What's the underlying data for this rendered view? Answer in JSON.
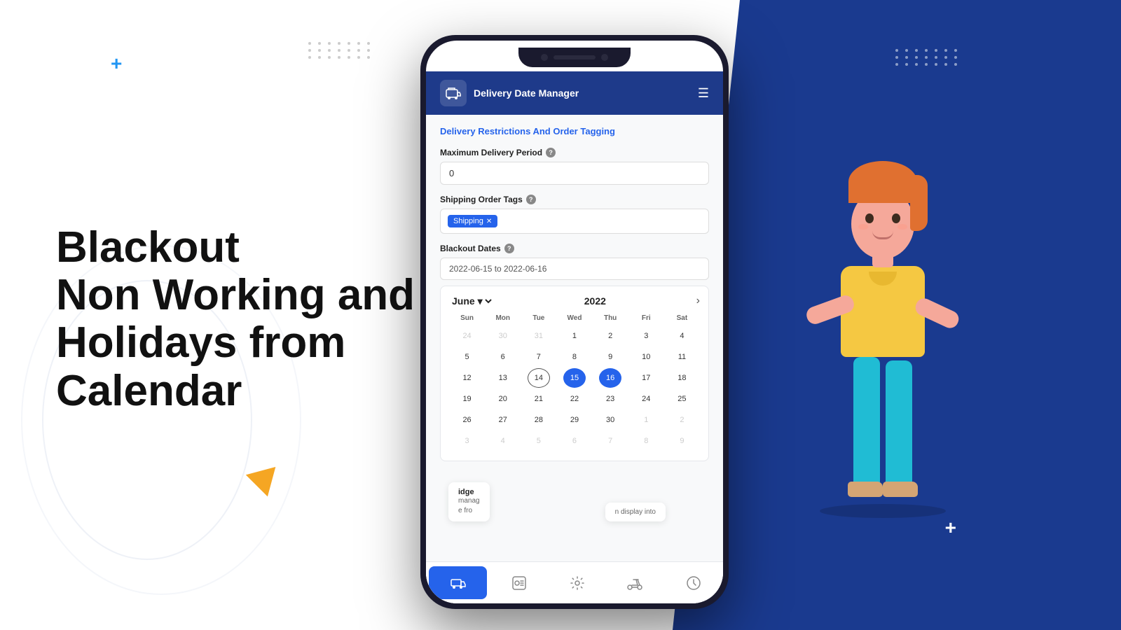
{
  "background": {
    "left_color": "#ffffff",
    "right_color": "#1a3a8f"
  },
  "decorations": {
    "plus_blue": "+",
    "plus_white": "+",
    "triangle_color": "#f5a623",
    "dots_color": "#cccccc",
    "dots_right_color": "rgba(255,255,255,0.5)"
  },
  "headline": {
    "line1": "Blackout",
    "line2": "Non Working and",
    "line3": "Holidays from",
    "line4": "Calendar"
  },
  "app": {
    "header": {
      "title": "Delivery Date\nManager",
      "menu_icon": "☰",
      "logo_icon": "🚚"
    },
    "section_title": "Delivery Restrictions And Order Tagging",
    "fields": {
      "max_delivery_label": "Maximum Delivery Period",
      "max_delivery_value": "0",
      "max_delivery_placeholder": "0",
      "shipping_tags_label": "Shipping Order Tags",
      "tag_text": "Shipping",
      "blackout_label": "Blackout Dates",
      "blackout_value": "2022-06-15 to 2022-06-16"
    },
    "calendar": {
      "month": "June",
      "year": "2022",
      "day_names": [
        "Sun",
        "Mon",
        "Tue",
        "Wed",
        "Thu",
        "Fri",
        "Sat"
      ],
      "weeks": [
        [
          "24",
          "30",
          "31",
          "1",
          "2",
          "3",
          "4"
        ],
        [
          "5",
          "6",
          "7",
          "8",
          "9",
          "10",
          "11"
        ],
        [
          "12",
          "13",
          "14",
          "15",
          "16",
          "17",
          "18"
        ],
        [
          "19",
          "20",
          "21",
          "22",
          "23",
          "24",
          "25"
        ],
        [
          "26",
          "27",
          "28",
          "29",
          "30",
          "1",
          "2"
        ],
        [
          "3",
          "4",
          "5",
          "6",
          "7",
          "8",
          "9"
        ]
      ],
      "selected_start": "15",
      "selected_end": "16",
      "circled_date": "14",
      "other_month_start": [
        "24",
        "30",
        "31"
      ],
      "other_month_end": [
        "1",
        "2"
      ],
      "other_month_end2": [
        "3",
        "4",
        "5",
        "6",
        "7",
        "8",
        "9"
      ]
    },
    "bottom_nav": {
      "items": [
        {
          "icon": "🚚",
          "active": true
        },
        {
          "icon": "📦",
          "active": false
        },
        {
          "icon": "⚙️",
          "active": false
        },
        {
          "icon": "🛵",
          "active": false
        },
        {
          "icon": "🕐",
          "active": false
        }
      ]
    }
  },
  "left_overlay": {
    "label": "idge",
    "sub1": "manag",
    "sub2": "e fro"
  },
  "right_overlay": {
    "sub": "n display into"
  }
}
